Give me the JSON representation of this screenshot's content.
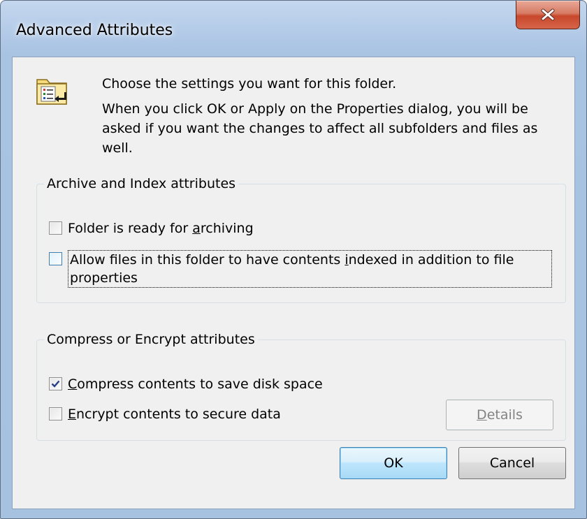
{
  "window": {
    "title": "Advanced Attributes",
    "close_icon": "close-x-icon"
  },
  "intro": {
    "icon": "folder-attributes-icon",
    "line1": "Choose the settings you want for this folder.",
    "line2": "When you click OK or Apply on the Properties dialog, you will be asked if you want the changes to affect all subfolders and files as well."
  },
  "archive_group": {
    "title": "Archive and Index attributes",
    "archiving": {
      "label_before": "Folder is ready for ",
      "label_accel": "a",
      "label_after": "rchiving",
      "checked": false
    },
    "indexing": {
      "label_before": "Allow files in this folder to have contents ",
      "label_accel": "i",
      "label_after": "ndexed in addition to file properties",
      "checked": false
    }
  },
  "compress_group": {
    "title": "Compress or Encrypt attributes",
    "compress": {
      "label_accel": "C",
      "label_after": "ompress contents to save disk space",
      "checked": true
    },
    "encrypt": {
      "label_accel": "E",
      "label_after": "ncrypt contents to secure data",
      "checked": false
    },
    "details_button": {
      "accel": "D",
      "rest": "etails",
      "enabled": false
    }
  },
  "buttons": {
    "ok": "OK",
    "cancel": "Cancel"
  },
  "colors": {
    "title_glass": "#b9cfea",
    "close_red": "#c8472b",
    "dialog_bg": "#f0f0f0",
    "default_button_border": "#3c7fb1"
  }
}
